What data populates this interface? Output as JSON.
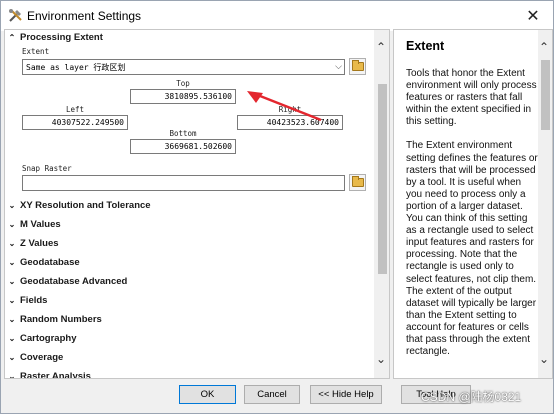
{
  "window": {
    "title": "Environment Settings",
    "close_glyph": "✕"
  },
  "processing_extent": {
    "header": "Processing Extent",
    "extent_label": "Extent",
    "extent_value": "Same as layer 行政区划",
    "top_label": "Top",
    "top_value": "3810895.536100",
    "left_label": "Left",
    "left_value": "40307522.249500",
    "right_label": "Right",
    "right_value": "40423523.607400",
    "bottom_label": "Bottom",
    "bottom_value": "3669681.502600",
    "snap_label": "Snap Raster",
    "snap_value": ""
  },
  "sections": [
    "XY Resolution and Tolerance",
    "M Values",
    "Z Values",
    "Geodatabase",
    "Geodatabase Advanced",
    "Fields",
    "Random Numbers",
    "Cartography",
    "Coverage",
    "Raster Analysis"
  ],
  "help": {
    "title": "Extent",
    "paragraphs": [
      "Tools that honor the Extent environment will only process features or rasters that fall within the extent specified in this setting.",
      "The Extent environment setting defines the features or rasters that will be processed by a tool. It is useful when you need to process only a portion of a larger dataset. You can think of this setting as a rectangle used to select input features and rasters for processing. Note that the rectangle is used only to select features, not clip them. The extent of the output dataset will typically be larger than the Extent setting to account for features or cells that pass through the extent rectangle."
    ]
  },
  "buttons": {
    "ok": "OK",
    "cancel": "Cancel",
    "hide_help": "<< Hide Help",
    "tool_help": "Tool Help"
  },
  "watermark": "CSDN @陆杨0321",
  "icons": {
    "title": "tools-icon",
    "folder": "folder-open-icon",
    "annotation": "red-arrow-annotation"
  },
  "colors": {
    "annotation_red": "#e3262e",
    "default_button_border": "#0078d7"
  }
}
